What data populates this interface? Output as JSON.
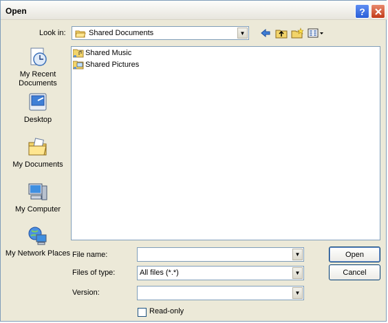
{
  "window": {
    "title": "Open"
  },
  "lookin": {
    "label": "Look in:",
    "value": "Shared Documents"
  },
  "toolbar": {
    "icons": [
      "back-icon",
      "up-folder-icon",
      "new-folder-icon",
      "views-menu-icon"
    ]
  },
  "places": [
    {
      "label": "My Recent Documents",
      "icon": "recent-documents-icon"
    },
    {
      "label": "Desktop",
      "icon": "desktop-icon"
    },
    {
      "label": "My Documents",
      "icon": "my-documents-icon"
    },
    {
      "label": "My Computer",
      "icon": "my-computer-icon"
    },
    {
      "label": "My Network Places",
      "icon": "network-places-icon"
    }
  ],
  "files": [
    {
      "name": "Shared Music",
      "icon": "shared-music-folder-icon"
    },
    {
      "name": "Shared Pictures",
      "icon": "shared-pictures-folder-icon"
    }
  ],
  "form": {
    "filename_label": "File name:",
    "filename_value": "",
    "filetype_label": "Files of type:",
    "filetype_value": "All files (*.*)",
    "version_label": "Version:",
    "version_value": "",
    "readonly_label": "Read-only"
  },
  "buttons": {
    "open": "Open",
    "cancel": "Cancel"
  },
  "colors": {
    "accent": "#003c74",
    "window_bg": "#ece9d8",
    "border": "#7f9db9"
  }
}
